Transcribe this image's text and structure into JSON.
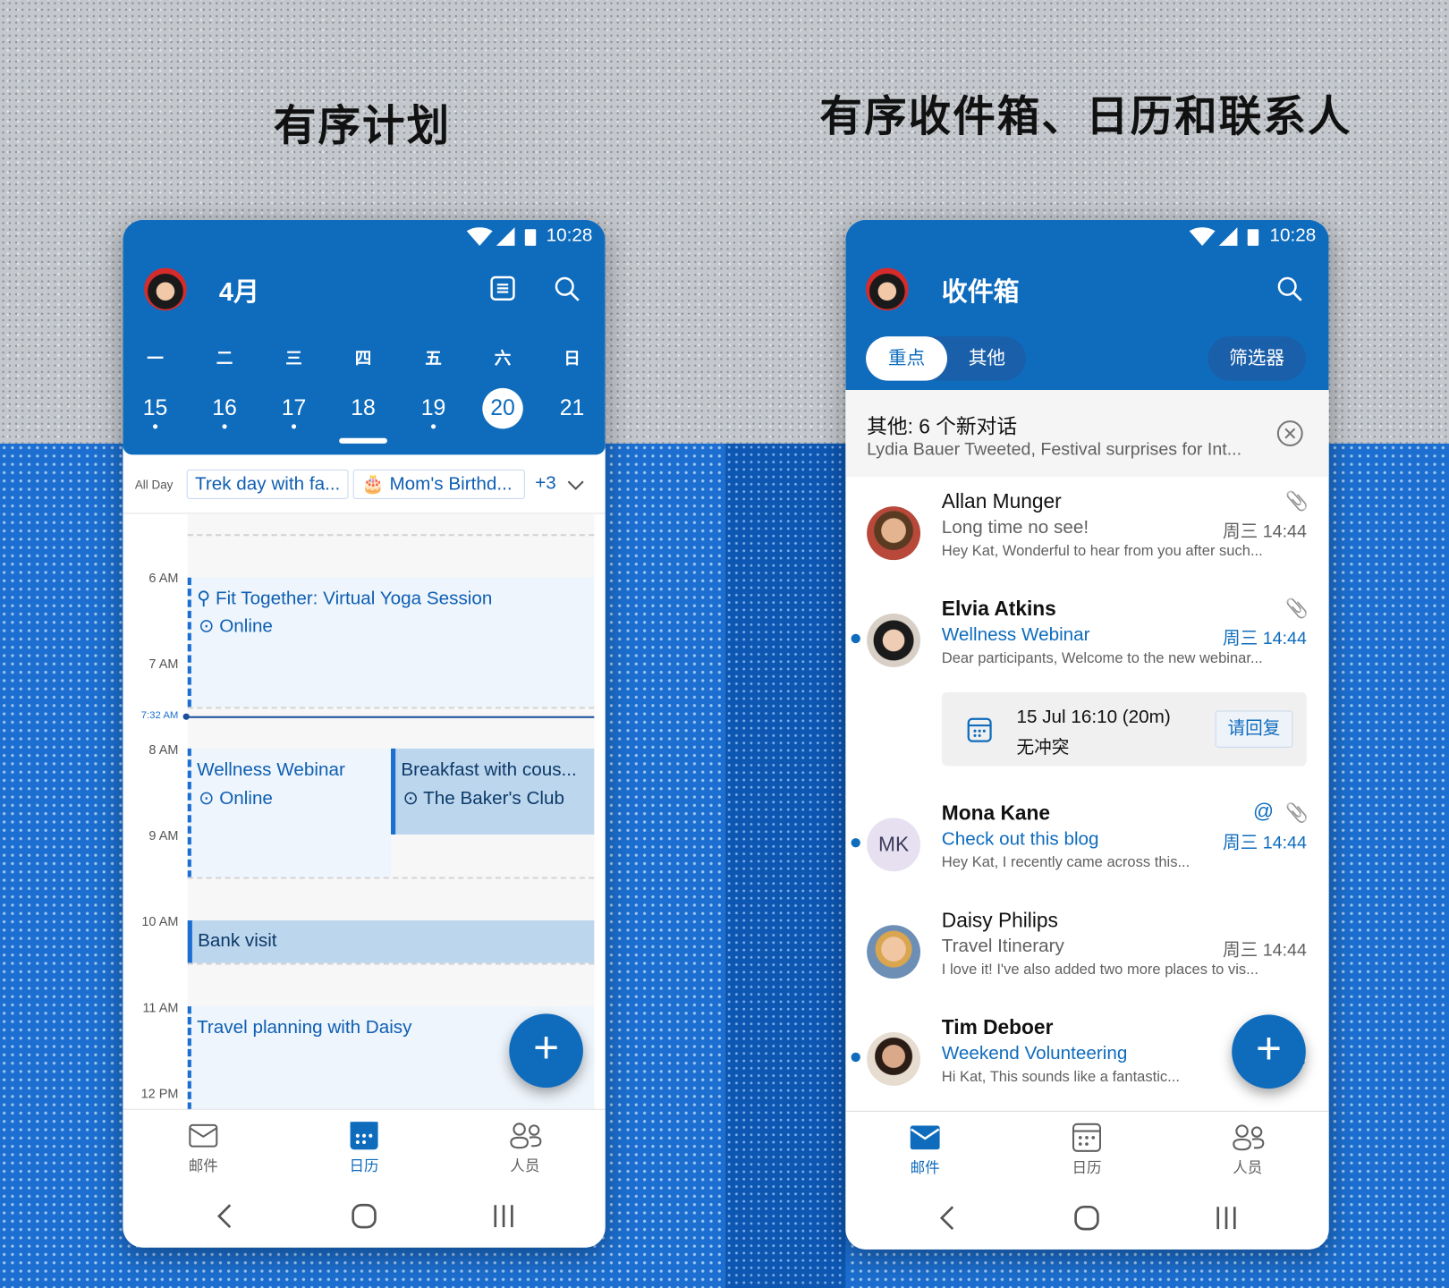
{
  "headlines": {
    "left": "有序计划",
    "right": "有序收件箱、日历和联系人"
  },
  "colors": {
    "accent": "#0f6cbd",
    "event_light": "#eef5fc",
    "event_busy": "#bcd6ee"
  },
  "status_bar": {
    "time": "10:28",
    "icons": [
      "wifi-icon",
      "signal-icon",
      "battery-icon"
    ]
  },
  "calendar": {
    "title": "4月",
    "weekdays": [
      "一",
      "二",
      "三",
      "四",
      "五",
      "六",
      "日"
    ],
    "dates": [
      {
        "d": "15",
        "dot": true
      },
      {
        "d": "16",
        "dot": true
      },
      {
        "d": "17",
        "dot": true
      },
      {
        "d": "18",
        "dot": false
      },
      {
        "d": "19",
        "dot": true
      },
      {
        "d": "20",
        "dot": false,
        "selected": true
      },
      {
        "d": "21",
        "dot": false
      }
    ],
    "all_day_label": "All Day",
    "all_day_events": [
      "Trek day with fa...",
      "Mom's Birthd..."
    ],
    "more_count": "+3",
    "hours": [
      "6 AM",
      "7 AM",
      "8 AM",
      "9 AM",
      "10 AM",
      "11 AM",
      "12 PM"
    ],
    "now_label": "7:32 AM",
    "events": [
      {
        "title": "Fit Together: Virtual Yoga Session",
        "location": "Online"
      },
      {
        "title": "Wellness Webinar",
        "location": "Online"
      },
      {
        "title": "Breakfast with cous...",
        "location": "The Baker's Club"
      },
      {
        "title": "Bank visit"
      },
      {
        "title": "Travel planning with Daisy"
      }
    ]
  },
  "inbox": {
    "title": "收件箱",
    "tabs": [
      "重点",
      "其他"
    ],
    "filter_label": "筛选器",
    "banner": {
      "title": "其他: 6 个新对话",
      "subtitle": "Lydia Bauer Tweeted, Festival surprises for Int..."
    },
    "messages": [
      {
        "sender": "Allan Munger",
        "subject": "Long time no see!",
        "time": "周三 14:44",
        "preview": "Hey Kat, Wonderful to hear from you after such...",
        "unread": false,
        "attachment": true
      },
      {
        "sender": "Elvia Atkins",
        "subject": "Wellness Webinar",
        "time": "周三 14:44",
        "preview": "Dear participants, Welcome to the new webinar...",
        "unread": true,
        "attachment": true
      },
      {
        "sender": "Mona Kane",
        "initials": "MK",
        "subject": "Check out this blog",
        "time": "周三 14:44",
        "preview": "Hey Kat, I recently came across this...",
        "unread": true,
        "attachment": true,
        "mention": true
      },
      {
        "sender": "Daisy Philips",
        "subject": "Travel Itinerary",
        "time": "周三 14:44",
        "preview": "I love it! I've also added two more places to vis...",
        "unread": false
      },
      {
        "sender": "Tim Deboer",
        "subject": "Weekend Volunteering",
        "time": "周",
        "preview": "Hi Kat, This sounds like a fantastic...",
        "unread": true
      }
    ],
    "meeting": {
      "when": "15 Jul 16:10 (20m)",
      "conflict": "无冲突",
      "rsvp_label": "请回复"
    }
  },
  "bottom_nav": [
    "邮件",
    "日历",
    "人员"
  ]
}
